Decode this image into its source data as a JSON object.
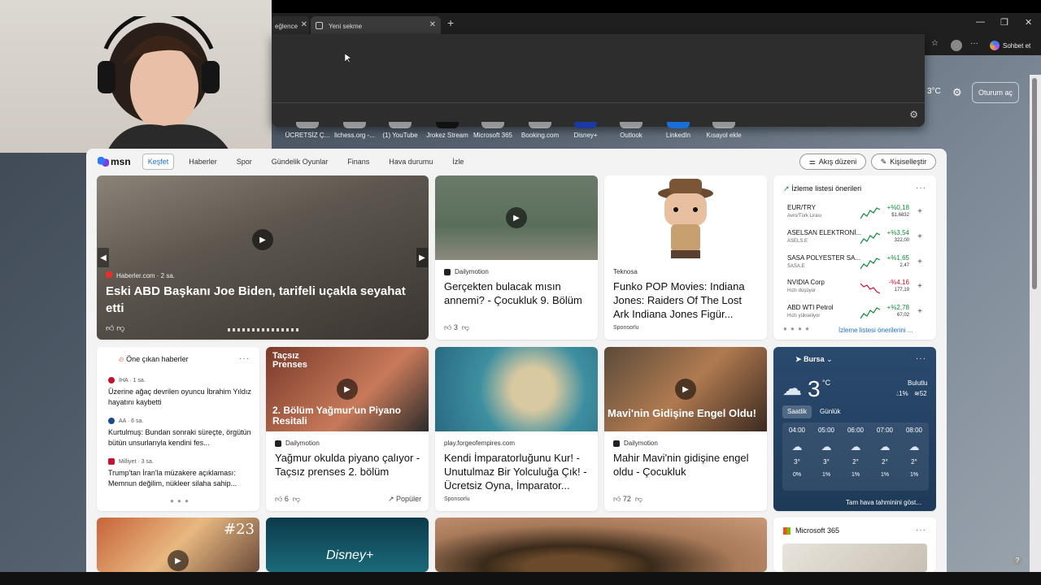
{
  "browser": {
    "tabs": [
      {
        "label": "eğlence"
      },
      {
        "label": "Yeni sekme"
      }
    ],
    "new_tab": "+",
    "copilot_label": "Sohbet et",
    "window_controls": [
      "—",
      "❐",
      "✕"
    ]
  },
  "shortcuts": [
    "ÜCRETSİZ Ç...",
    "lichess.org -...",
    "(1) YouTube",
    "Jrokez Stream",
    "Microsoft 365",
    "Booking.com",
    "Disney+",
    "Outlook",
    "LinkedIn",
    "Kısayol ekle"
  ],
  "top_right": {
    "temperature": "3°C",
    "signin": "Oturum aç"
  },
  "nav": {
    "brand": "msn",
    "items": [
      "Keşfet",
      "Haberler",
      "Spor",
      "Gündelik Oyunlar",
      "Finans",
      "Hava durumu",
      "İzle"
    ],
    "active": "Keşfet",
    "flow_button": "Akış düzeni",
    "personalize_button": "Kişiselleştir"
  },
  "hero": {
    "source": "Haberler.com · 2 sa.",
    "title": "Eski ABD Başkanı Joe Biden, tarifeli uçakla seyahat etti"
  },
  "cards": {
    "c2": {
      "source": "Dailymotion",
      "title": "Gerçekten bulacak mısın annemi? - Çocukluk 9. Bölüm",
      "likes": "3"
    },
    "c3": {
      "source": "Teknosa",
      "title": "Funko POP Movies: Indiana Jones: Raiders Of The Lost Ark Indiana Jones Figür...",
      "badge": "Sponsorlu"
    },
    "c5": {
      "source": "Dailymotion",
      "title": "Yağmur okulda piyano çalıyor - Taçsız prenses 2. bölüm",
      "likes": "6",
      "tag": "Popüler",
      "overlay_top": "Taçsız Prenses",
      "overlay_bottom": "2. Bölüm Yağmur'un Piyano Resitali"
    },
    "c6": {
      "source": "play.forgeofempires.com",
      "title": "Kendi İmparatorluğunu Kur! - Unutulmaz Bir Yolculuğa Çık! - Ücretsiz Oyna, İmparator...",
      "badge": "Sponsorlu"
    },
    "c7": {
      "source": "Dailymotion",
      "title": "Mahir Mavi'nin gidişine engel oldu - Çocukluk",
      "likes": "72",
      "overlay_bottom": "Mavi'nin Gidişine Engel Oldu!"
    }
  },
  "watchlist": {
    "title": "İzleme listesi önerileri",
    "link": "İzleme listesi önerilerini ...",
    "items": [
      {
        "name": "EUR/TRY",
        "sub": "Avro/Türk Lirası",
        "change": "+%0,18",
        "price": "$1,6832",
        "up": true
      },
      {
        "name": "ASELSAN ELEKTRONİ...",
        "sub": "ASELS.E",
        "change": "+%3,54",
        "price": "322,00",
        "up": true
      },
      {
        "name": "SASA POLYESTER SA...",
        "sub": "SASA.E",
        "change": "+%1,65",
        "price": "2,47",
        "up": true
      },
      {
        "name": "NVIDIA Corp",
        "sub": "Hızlı düşüyor",
        "change": "-%4,16",
        "price": "177,19",
        "up": false
      },
      {
        "name": "ABD WTI Petrol",
        "sub": "Hızlı yükseliyor",
        "change": "+%2,78",
        "price": "67,02",
        "up": true
      }
    ],
    "colors": {
      "up": "#0e8a3a",
      "down": "#c8102e"
    }
  },
  "trending": {
    "title": "Öne çıkan haberler",
    "items": [
      {
        "source": "İHA · 1 sa.",
        "title": "Üzerine ağaç devrilen oyuncu İbrahim Yıldız hayatını kaybetti"
      },
      {
        "source": "AA · 6 sa.",
        "title": "Kurtulmuş: Bundan sonraki süreçte, örgütün bütün unsurlarıyla kendini fes..."
      },
      {
        "source": "Milliyet · 3 sa.",
        "title": "Trump'tan İran'la müzakere açıklaması: Memnun değilim, nükleer silaha sahip..."
      }
    ]
  },
  "weather": {
    "city": "Bursa",
    "temp": "3",
    "unit": "°C",
    "condition": "Bulutlu",
    "rain": "1%",
    "humidity": "52",
    "tabs": [
      "Saatlik",
      "Günlük"
    ],
    "hours": [
      {
        "h": "04:00",
        "t": "3°",
        "p": "0%"
      },
      {
        "h": "05:00",
        "t": "3°",
        "p": "1%"
      },
      {
        "h": "06:00",
        "t": "2°",
        "p": "1%"
      },
      {
        "h": "07:00",
        "t": "2°",
        "p": "1%"
      },
      {
        "h": "08:00",
        "t": "2°",
        "p": "1%"
      }
    ],
    "full_link": "Tam hava tahminini göst..."
  },
  "row3": {
    "m365_title": "Microsoft 365",
    "r3a_overlay": "#23",
    "r3b_overlay": "Disney+"
  }
}
